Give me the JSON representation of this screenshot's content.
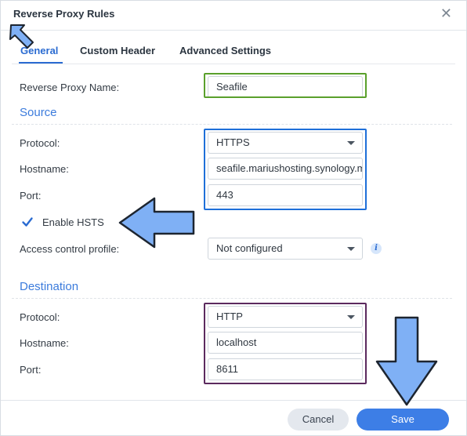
{
  "dialog": {
    "title": "Reverse Proxy Rules"
  },
  "tabs": [
    {
      "label": "General",
      "active": true
    },
    {
      "label": "Custom Header",
      "active": false
    },
    {
      "label": "Advanced Settings",
      "active": false
    }
  ],
  "form": {
    "name_label": "Reverse Proxy Name:",
    "name_value": "Seafile",
    "source": {
      "heading": "Source",
      "protocol_label": "Protocol:",
      "protocol_value": "HTTPS",
      "hostname_label": "Hostname:",
      "hostname_value": "seafile.mariushosting.synology.me",
      "port_label": "Port:",
      "port_value": "443",
      "hsts_label": "Enable HSTS",
      "hsts_checked": true,
      "acl_label": "Access control profile:",
      "acl_value": "Not configured"
    },
    "destination": {
      "heading": "Destination",
      "protocol_label": "Protocol:",
      "protocol_value": "HTTP",
      "hostname_label": "Hostname:",
      "hostname_value": "localhost",
      "port_label": "Port:",
      "port_value": "8611"
    }
  },
  "footer": {
    "cancel_label": "Cancel",
    "save_label": "Save"
  },
  "icons": {
    "close": "close-icon",
    "info": "info-icon",
    "caret": "chevron-down-icon",
    "check": "checkmark-icon"
  },
  "colors": {
    "accent": "#3d7ee6",
    "section_heading": "#3b7bdc",
    "highlight_name": "#5aa02c",
    "highlight_source": "#1e6fd9",
    "highlight_destination": "#5b2a5e",
    "annotation_arrow": "#7fb0f5"
  }
}
